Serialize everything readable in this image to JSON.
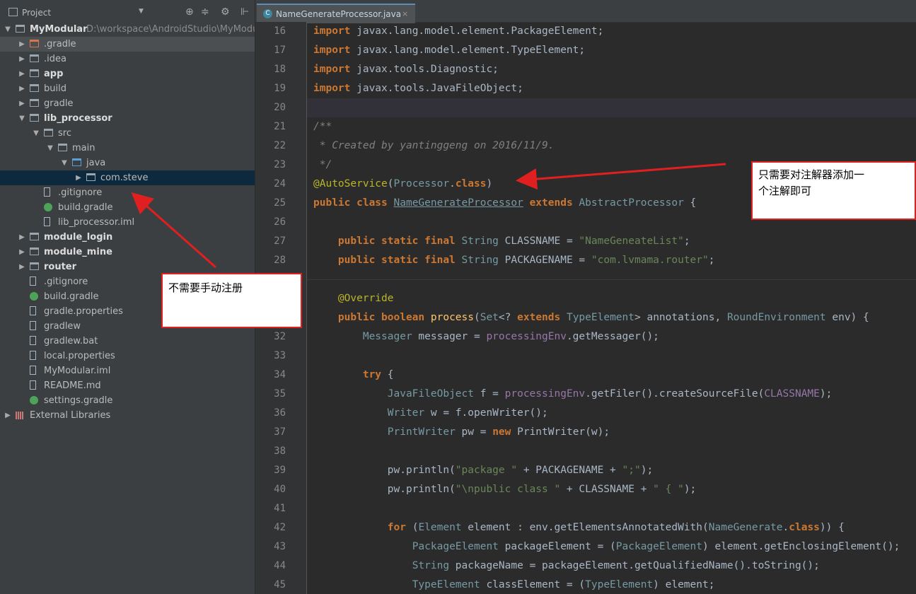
{
  "panel": {
    "title": "Project",
    "dropdown_icon": "chevron-down-icon",
    "icons": [
      "target-icon",
      "collapse-icon",
      "gear-icon",
      "split-icon"
    ]
  },
  "tree": [
    {
      "label": "MyModular",
      "path": "D:\\workspace\\AndroidStudio\\MyModula",
      "depth": 0,
      "icon": "module",
      "arrow": "▼",
      "bold": true
    },
    {
      "label": ".gradle",
      "depth": 1,
      "icon": "folder-red",
      "arrow": "▶"
    },
    {
      "label": ".idea",
      "depth": 1,
      "icon": "folder",
      "arrow": "▶"
    },
    {
      "label": "app",
      "depth": 1,
      "icon": "module",
      "arrow": "▶",
      "bold": true
    },
    {
      "label": "build",
      "depth": 1,
      "icon": "folder",
      "arrow": "▶"
    },
    {
      "label": "gradle",
      "depth": 1,
      "icon": "folder",
      "arrow": "▶"
    },
    {
      "label": "lib_processor",
      "depth": 1,
      "icon": "module",
      "arrow": "▼",
      "bold": true
    },
    {
      "label": "src",
      "depth": 2,
      "icon": "folder",
      "arrow": "▼"
    },
    {
      "label": "main",
      "depth": 3,
      "icon": "folder",
      "arrow": "▼"
    },
    {
      "label": "java",
      "depth": 4,
      "icon": "folder-blue",
      "arrow": "▼"
    },
    {
      "label": "com.steve",
      "depth": 5,
      "icon": "folder",
      "arrow": "▶",
      "selected": true
    },
    {
      "label": ".gitignore",
      "depth": 2,
      "icon": "file"
    },
    {
      "label": "build.gradle",
      "depth": 2,
      "icon": "gradle"
    },
    {
      "label": "lib_processor.iml",
      "depth": 2,
      "icon": "file"
    },
    {
      "label": "module_login",
      "depth": 1,
      "icon": "module",
      "arrow": "▶",
      "bold": true
    },
    {
      "label": "module_mine",
      "depth": 1,
      "icon": "module",
      "arrow": "▶",
      "bold": true
    },
    {
      "label": "router",
      "depth": 1,
      "icon": "module",
      "arrow": "▶",
      "bold": true
    },
    {
      "label": ".gitignore",
      "depth": 1,
      "icon": "file"
    },
    {
      "label": "build.gradle",
      "depth": 1,
      "icon": "gradle"
    },
    {
      "label": "gradle.properties",
      "depth": 1,
      "icon": "file"
    },
    {
      "label": "gradlew",
      "depth": 1,
      "icon": "file"
    },
    {
      "label": "gradlew.bat",
      "depth": 1,
      "icon": "file"
    },
    {
      "label": "local.properties",
      "depth": 1,
      "icon": "file"
    },
    {
      "label": "MyModular.iml",
      "depth": 1,
      "icon": "file"
    },
    {
      "label": "README.md",
      "depth": 1,
      "icon": "file"
    },
    {
      "label": "settings.gradle",
      "depth": 1,
      "icon": "gradle"
    },
    {
      "label": "External Libraries",
      "depth": 0,
      "icon": "lib",
      "arrow": "▶"
    }
  ],
  "editor": {
    "tab_label": "NameGenerateProcessor.java",
    "tab_icon": "C",
    "tab_close": "×",
    "lines": [
      {
        "n": "16",
        "html": "<span class=\"k\">import</span> javax.lang.model.element.PackageElement;"
      },
      {
        "n": "17",
        "html": "<span class=\"k\">import</span> javax.lang.model.element.TypeElement;"
      },
      {
        "n": "18",
        "html": "<span class=\"k\">import</span> javax.tools.Diagnostic;"
      },
      {
        "n": "19",
        "html": "<span class=\"k\">import</span> javax.tools.JavaFileObject;"
      },
      {
        "n": "20",
        "html": "",
        "current": true
      },
      {
        "n": "21",
        "html": "<span class=\"c\">/**</span>"
      },
      {
        "n": "22",
        "html": "<span class=\"c\"> * Created by yantinggeng on 2016/11/9.</span>"
      },
      {
        "n": "23",
        "html": "<span class=\"c\"> */</span>"
      },
      {
        "n": "24",
        "html": "<span class=\"a\">@AutoService</span>(<span class=\"t\">Processor</span>.<span class=\"k\">class</span>)"
      },
      {
        "n": "25",
        "html": "<span class=\"k\">public class</span> <span class=\"t\" style=\"text-decoration:underline\">NameGenerateProcessor</span> <span class=\"k\">extends</span> <span class=\"t\">AbstractProcessor</span> {"
      },
      {
        "n": "26",
        "html": ""
      },
      {
        "n": "27",
        "html": "    <span class=\"k\">public static final</span> <span class=\"t\">String</span> CLASSNAME = <span class=\"s\">\"NameGeneateList\"</span>;"
      },
      {
        "n": "28",
        "html": "    <span class=\"k\">public static final</span> <span class=\"t\">String</span> PACKAGENAME = <span class=\"s\">\"com.lvmama.router\"</span>;"
      },
      {
        "n": "29",
        "html": ""
      },
      {
        "n": "30",
        "html": "    <span class=\"a\">@Override</span>"
      },
      {
        "n": "31",
        "html": "    <span class=\"k\">public boolean</span> <span class=\"f\">process</span>(<span class=\"t\">Set</span>&lt;? <span class=\"k\">extends</span> <span class=\"t\">TypeElement</span>&gt; annotations, <span class=\"t\">RoundEnvironment</span> env) {"
      },
      {
        "n": "32",
        "html": "        <span class=\"t\">Messager</span> messager = <span class=\"fld\">processingEnv</span>.getMessager();"
      },
      {
        "n": "33",
        "html": ""
      },
      {
        "n": "34",
        "html": "        <span class=\"k\">try</span> {"
      },
      {
        "n": "35",
        "html": "            <span class=\"t\">JavaFileObject</span> f = <span class=\"fld\">processingEnv</span>.getFiler().createSourceFile(<span class=\"fld\">CLASSNAME</span>);"
      },
      {
        "n": "36",
        "html": "            <span class=\"t\">Writer</span> w = f.openWriter();"
      },
      {
        "n": "37",
        "html": "            <span class=\"t\">PrintWriter</span> pw = <span class=\"k\">new</span> PrintWriter(w);"
      },
      {
        "n": "38",
        "html": ""
      },
      {
        "n": "39",
        "html": "            pw.println(<span class=\"s\">\"package \"</span> + PACKAGENAME + <span class=\"s\">\";\"</span>);"
      },
      {
        "n": "40",
        "html": "            pw.println(<span class=\"s\">\"\\npublic class \"</span> + CLASSNAME + <span class=\"s\">\" { \"</span>);"
      },
      {
        "n": "41",
        "html": ""
      },
      {
        "n": "42",
        "html": "            <span class=\"k\">for</span> (<span class=\"t\">Element</span> element : env.getElementsAnnotatedWith(<span class=\"t\">NameGenerate</span>.<span class=\"k\">class</span>)) {"
      },
      {
        "n": "43",
        "html": "                <span class=\"t\">PackageElement</span> packageElement = (<span class=\"t\">PackageElement</span>) element.getEnclosingElement();"
      },
      {
        "n": "44",
        "html": "                <span class=\"t\">String</span> packageName = packageElement.getQualifiedName().toString();"
      },
      {
        "n": "45",
        "html": "                <span class=\"t\">TypeElement</span> classElement = (<span class=\"t\">TypeElement</span>) element;"
      }
    ]
  },
  "annotations": {
    "left_callout": "不需要手动注册",
    "right_callout_line1": "只需要对注解器添加一",
    "right_callout_line2": "个注解即可"
  },
  "colors": {
    "callout_border": "#e02020",
    "arrow": "#e02020",
    "selection": "#0d293e"
  }
}
